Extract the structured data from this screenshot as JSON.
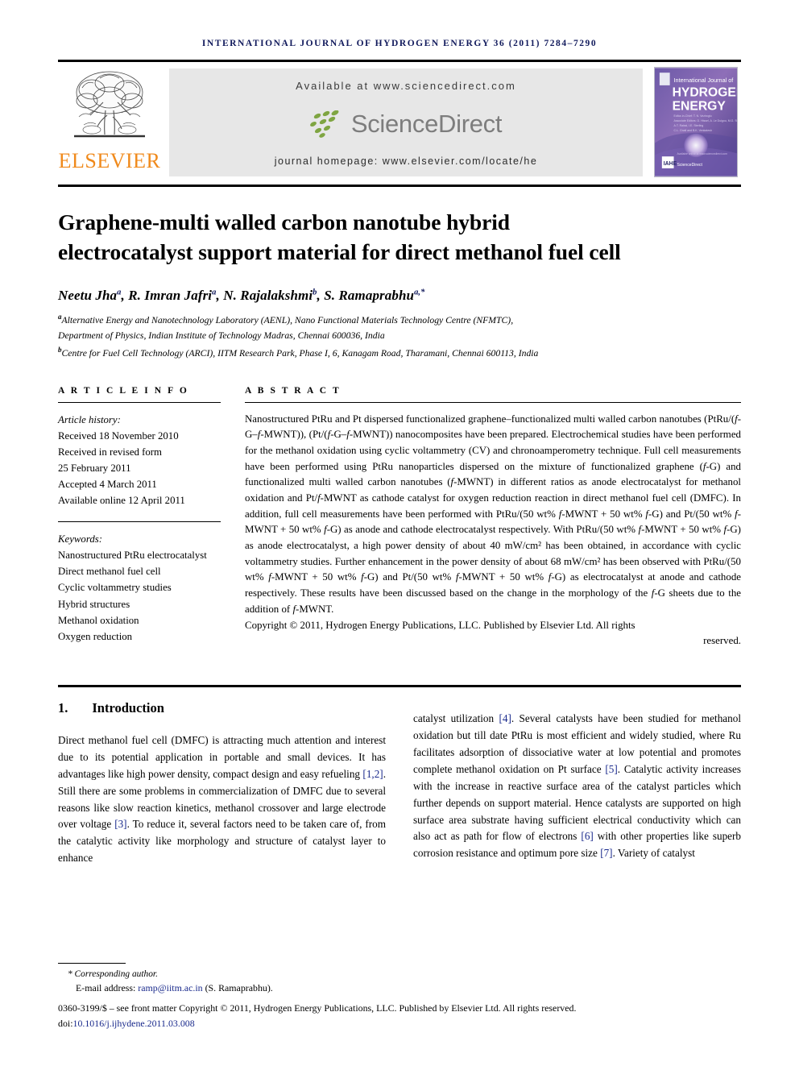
{
  "running_head": "INTERNATIONAL JOURNAL OF HYDROGEN ENERGY 36 (2011) 7284–7290",
  "masthead": {
    "publisher_wordmark": "ELSEVIER",
    "available_line": "Available at www.sciencedirect.com",
    "sciencedirect_label": "ScienceDirect",
    "homepage_line": "journal homepage: www.elsevier.com/locate/he",
    "cover": {
      "line1": "International Journal of",
      "line2": "HYDROGEN",
      "line3": "ENERGY",
      "badge": "IAHE",
      "footer_brand": "ScienceDirect"
    },
    "colors": {
      "elsevier_orange": "#f08a1c",
      "sciencedirect_green": "#789b3d",
      "sciencedirect_gray": "#7d7d7d",
      "panel_gray": "#e7e7e7",
      "link_navy": "#1a2a8c",
      "running_head_navy": "#111a5c"
    }
  },
  "article": {
    "title_line1": "Graphene-multi walled carbon nanotube hybrid",
    "title_line2": "electrocatalyst support material for direct methanol fuel cell",
    "authors": [
      {
        "name": "Neetu Jha",
        "sup": "a"
      },
      {
        "name": "R. Imran Jafri",
        "sup": "a"
      },
      {
        "name": "N. Rajalakshmi",
        "sup": "b"
      },
      {
        "name": "S. Ramaprabhu",
        "sup": "a,*"
      }
    ],
    "affiliations": [
      {
        "marker": "a",
        "line1": "Alternative Energy and Nanotechnology Laboratory (AENL), Nano Functional Materials Technology Centre (NFMTC),",
        "line2": "Department of Physics, Indian Institute of Technology Madras, Chennai 600036, India"
      },
      {
        "marker": "b",
        "line1": "Centre for Fuel Cell Technology (ARCI), IITM Research Park, Phase I, 6, Kanagam Road, Tharamani, Chennai 600113, India"
      }
    ]
  },
  "article_info": {
    "heading": "A R T I C L E   I N F O",
    "history_label": "Article history:",
    "history": [
      "Received 18 November 2010",
      "Received in revised form",
      "25 February 2011",
      "Accepted 4 March 2011",
      "Available online 12 April 2011"
    ],
    "keywords_label": "Keywords:",
    "keywords": [
      "Nanostructured PtRu electrocatalyst",
      "Direct methanol fuel cell",
      "Cyclic voltammetry studies",
      "Hybrid structures",
      "Methanol oxidation",
      "Oxygen reduction"
    ]
  },
  "abstract": {
    "heading": "A B S T R A C T",
    "body": "Nanostructured PtRu and Pt dispersed functionalized graphene–functionalized multi walled carbon nanotubes (PtRu/(f-G–f-MWNT)), (Pt/(f-G–f-MWNT)) nanocomposites have been prepared. Electrochemical studies have been performed for the methanol oxidation using cyclic voltammetry (CV) and chronoamperometry technique. Full cell measurements have been performed using PtRu nanoparticles dispersed on the mixture of functionalized graphene (f-G) and functionalized multi walled carbon nanotubes (f-MWNT) in different ratios as anode electrocatalyst for methanol oxidation and Pt/f-MWNT as cathode catalyst for oxygen reduction reaction in direct methanol fuel cell (DMFC). In addition, full cell measurements have been performed with PtRu/(50 wt% f-MWNT + 50 wt% f-G) and Pt/(50 wt% f-MWNT + 50 wt% f-G) as anode and cathode electrocatalyst respectively. With PtRu/(50 wt% f-MWNT + 50 wt% f-G) as anode electrocatalyst, a high power density of about 40 mW/cm² has been obtained, in accordance with cyclic voltammetry studies. Further enhancement in the power density of about 68 mW/cm² has been observed with PtRu/(50 wt% f-MWNT + 50 wt% f-G) and Pt/(50 wt% f-MWNT + 50 wt% f-G) as electrocatalyst at anode and cathode respectively. These results have been discussed based on the change in the morphology of the f-G sheets due to the addition of f-MWNT.",
    "copyright": "Copyright © 2011, Hydrogen Energy Publications, LLC. Published by Elsevier Ltd. All rights",
    "copyright_tail": "reserved."
  },
  "introduction": {
    "number": "1.",
    "heading": "Introduction",
    "left_paragraph": "Direct methanol fuel cell (DMFC) is attracting much attention and interest due to its potential application in portable and small devices. It has advantages like high power density, compact design and easy refueling [1,2]. Still there are some problems in commercialization of DMFC due to several reasons like slow reaction kinetics, methanol crossover and large electrode over voltage [3]. To reduce it, several factors need to be taken care of, from the catalytic activity like morphology and structure of catalyst layer to enhance",
    "right_paragraph": "catalyst utilization [4]. Several catalysts have been studied for methanol oxidation but till date PtRu is most efficient and widely studied, where Ru facilitates adsorption of dissociative water at low potential and promotes complete methanol oxidation on Pt surface [5]. Catalytic activity increases with the increase in reactive surface area of the catalyst particles which further depends on support material. Hence catalysts are supported on high surface area substrate having sufficient electrical conductivity which can also act as path for flow of electrons [6] with other properties like superb corrosion resistance and optimum pore size [7]. Variety of catalyst"
  },
  "footer": {
    "corresponding": "* Corresponding author.",
    "email_label": "E-mail address:",
    "email": "ramp@iitm.ac.in",
    "email_owner": "(S. Ramaprabhu).",
    "front_matter": "0360-3199/$ – see front matter Copyright © 2011, Hydrogen Energy Publications, LLC. Published by Elsevier Ltd. All rights reserved.",
    "doi_prefix": "doi:",
    "doi": "10.1016/j.ijhydene.2011.03.008"
  }
}
